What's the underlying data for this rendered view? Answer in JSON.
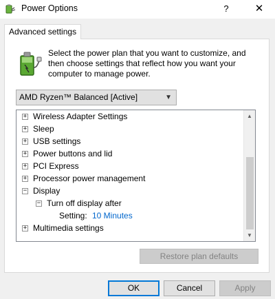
{
  "window": {
    "title": "Power Options",
    "help_glyph": "?",
    "close_glyph": "✕",
    "app_icon": "power-options-icon"
  },
  "tabs": [
    {
      "label": "Advanced settings",
      "selected": true
    }
  ],
  "intro": {
    "icon": "battery-plug-icon",
    "text": "Select the power plan that you want to customize, and then choose settings that reflect how you want your computer to manage power."
  },
  "plan_select": {
    "value": "AMD Ryzen™ Balanced [Active]"
  },
  "tree": {
    "items": [
      {
        "label": "Wireless Adapter Settings",
        "expander": "+"
      },
      {
        "label": "Sleep",
        "expander": "+"
      },
      {
        "label": "USB settings",
        "expander": "+"
      },
      {
        "label": "Power buttons and lid",
        "expander": "+"
      },
      {
        "label": "PCI Express",
        "expander": "+"
      },
      {
        "label": "Processor power management",
        "expander": "+"
      },
      {
        "label": "Display",
        "expander": "−"
      },
      {
        "label": "Turn off display after",
        "expander": "−"
      },
      {
        "label": "Setting:",
        "value": "10 Minutes"
      },
      {
        "label": "Multimedia settings",
        "expander": "+"
      }
    ],
    "scroll_up_glyph": "▲",
    "scroll_down_glyph": "▼"
  },
  "buttons": {
    "restore": "Restore plan defaults",
    "ok": "OK",
    "cancel": "Cancel",
    "apply": "Apply"
  },
  "colors": {
    "accent": "#0078d7",
    "setting_value": "#0066cc",
    "disabled_text": "#838383"
  }
}
